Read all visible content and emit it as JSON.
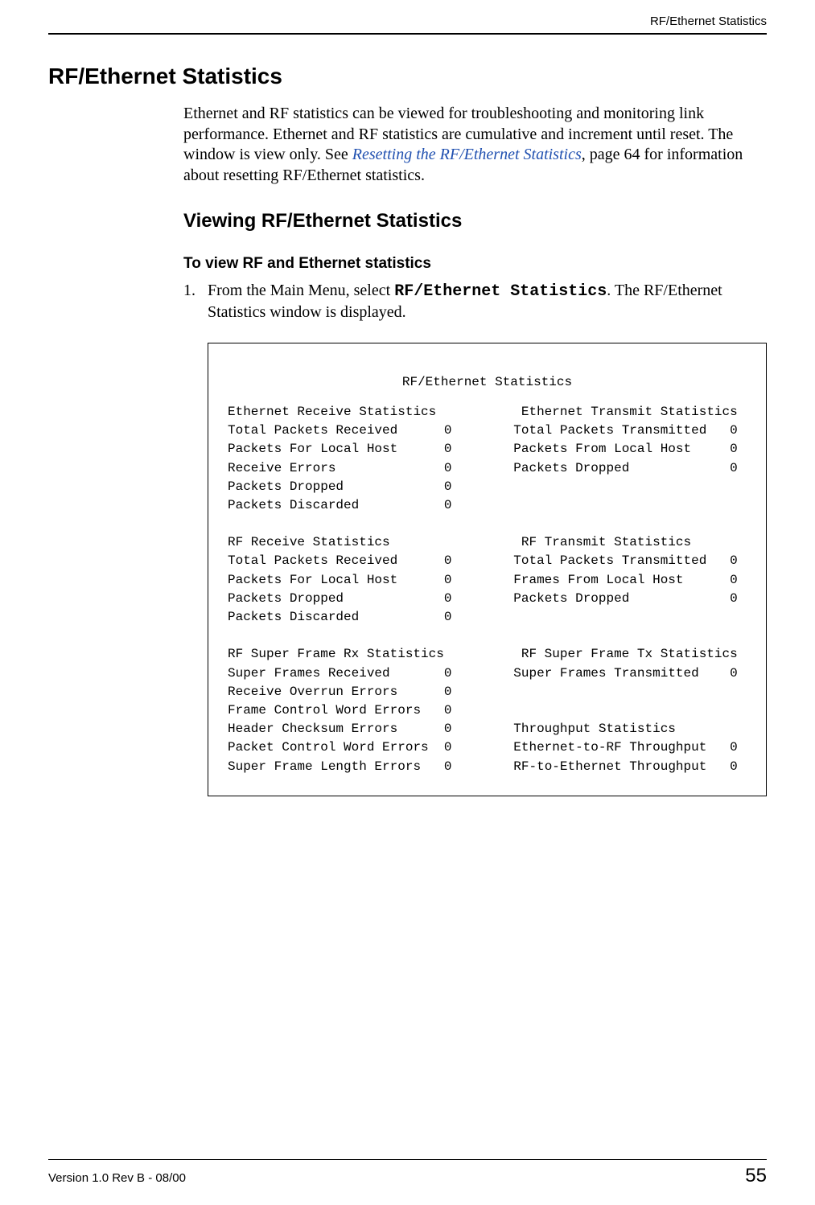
{
  "header": {
    "running_head": "RF/Ethernet Statistics"
  },
  "title": "RF/Ethernet Statistics",
  "intro": {
    "p1a": "Ethernet and RF statistics can be viewed for troubleshooting and monitoring link performance. Ethernet and RF statistics are cumulative and increment until reset. The window is view only. See ",
    "link": "Resetting the RF/Ethernet Statistics",
    "p1b": ", page 64 for information about resetting RF/Ethernet statistics."
  },
  "subhead": "Viewing RF/Ethernet Statistics",
  "procedure_head": "To view RF and Ethernet statistics",
  "step1": {
    "num": "1.",
    "a": "From the Main Menu, select ",
    "cmd": "RF/Ethernet Statistics",
    "b": ". The RF/Ethernet Statistics window is displayed."
  },
  "screen": {
    "title": "RF/Ethernet Statistics",
    "eth_rx_head": "Ethernet Receive Statistics",
    "eth_tx_head": "Ethernet Transmit Statistics",
    "eth_rx": [
      {
        "label": "Total Packets Received",
        "val": "0"
      },
      {
        "label": "Packets For Local Host",
        "val": "0"
      },
      {
        "label": "Receive Errors",
        "val": "0"
      },
      {
        "label": "Packets Dropped",
        "val": "0"
      },
      {
        "label": "Packets Discarded",
        "val": "0"
      }
    ],
    "eth_tx": [
      {
        "label": "Total Packets Transmitted",
        "val": "0"
      },
      {
        "label": "Packets From Local Host",
        "val": "0"
      },
      {
        "label": "Packets Dropped",
        "val": "0"
      }
    ],
    "rf_rx_head": "RF Receive Statistics",
    "rf_tx_head": "RF Transmit Statistics",
    "rf_rx": [
      {
        "label": "Total Packets Received",
        "val": "0"
      },
      {
        "label": "Packets For Local Host",
        "val": "0"
      },
      {
        "label": "Packets Dropped",
        "val": "0"
      },
      {
        "label": "Packets Discarded",
        "val": "0"
      }
    ],
    "rf_tx": [
      {
        "label": "Total Packets Transmitted",
        "val": "0"
      },
      {
        "label": "Frames From Local Host",
        "val": "0"
      },
      {
        "label": "Packets Dropped",
        "val": "0"
      }
    ],
    "sf_rx_head": "RF Super Frame Rx Statistics",
    "sf_tx_head": "RF Super Frame Tx Statistics",
    "sf_rx": [
      {
        "label": "Super Frames Received",
        "val": "0"
      },
      {
        "label": "Receive Overrun Errors",
        "val": "0"
      },
      {
        "label": "Frame Control Word Errors",
        "val": "0"
      },
      {
        "label": "Header Checksum Errors",
        "val": "0"
      },
      {
        "label": "Packet Control Word Errors",
        "val": "0"
      },
      {
        "label": "Super Frame Length Errors",
        "val": "0"
      }
    ],
    "sf_tx": [
      {
        "label": "Super Frames Transmitted",
        "val": "0"
      }
    ],
    "thr_head": "Throughput Statistics",
    "thr": [
      {
        "label": "Ethernet-to-RF Throughput",
        "val": "0"
      },
      {
        "label": "RF-to-Ethernet Throughput",
        "val": "0"
      }
    ]
  },
  "footer": {
    "left": "Version 1.0 Rev B - 08/00",
    "right": "55"
  }
}
